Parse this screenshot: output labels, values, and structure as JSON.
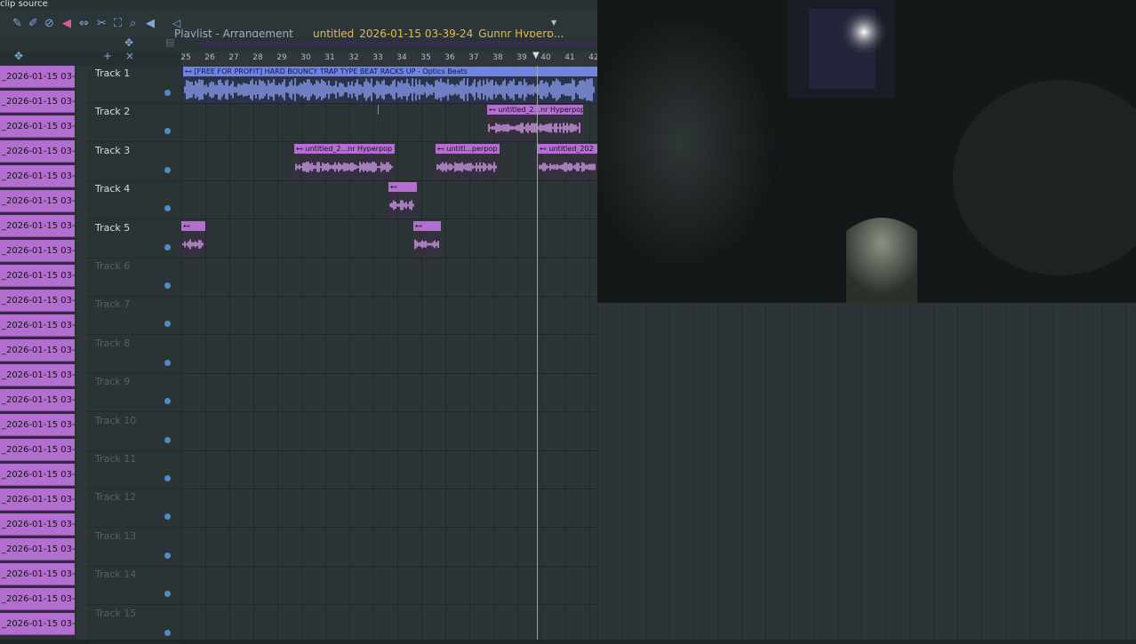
{
  "header": {
    "clip_source": "clip source",
    "playlist_title": "Playlist - Arrangement",
    "project_name": "untitled_2026-01-15 03-39-24_Gunnr Hyperp..."
  },
  "ruler": {
    "ticks": [
      "25",
      "26",
      "27",
      "28",
      "29",
      "30",
      "31",
      "32",
      "33",
      "34",
      "35",
      "36",
      "37",
      "38",
      "39",
      "40",
      "41",
      "42"
    ]
  },
  "sidebar": {
    "item_label": "_2026-01-15 03-..."
  },
  "tracks": [
    "Track 1",
    "Track 2",
    "Track 3",
    "Track 4",
    "Track 5",
    "Track 6",
    "Track 7",
    "Track 8",
    "Track 9",
    "Track 10",
    "Track 11",
    "Track 12",
    "Track 13",
    "Track 14",
    "Track 15"
  ],
  "clips": [
    {
      "track": 1,
      "label": "[FREE FOR PROFIT] HARD BOUNCY TRAP TYPE BEAT RACKS UP - Optics Beats",
      "style": "blue"
    },
    {
      "track": 2,
      "label": "untitled_202..unnr Hyperpop",
      "style": "purple"
    },
    {
      "track": 2,
      "label": "untitled_..r Hyperpop",
      "style": "purple"
    },
    {
      "track": 2,
      "label": "untitled_2...nr Hyperpop",
      "style": "purple"
    },
    {
      "track": 3,
      "label": "untitled_2...nr Hyperpop",
      "style": "purple"
    },
    {
      "track": 3,
      "label": "untitl...perpop",
      "style": "purple"
    },
    {
      "track": 3,
      "label": "untitled_202",
      "style": "purple"
    },
    {
      "track": 4,
      "label": "",
      "style": "purple"
    },
    {
      "track": 5,
      "label": "",
      "style": "purple"
    },
    {
      "track": 5,
      "label": "",
      "style": "purple"
    }
  ],
  "colors": {
    "clip_purple": "#b26fd0",
    "clip_blue": "#6f84e0",
    "project_name": "#e8b84a",
    "grid": "#2d3437"
  }
}
